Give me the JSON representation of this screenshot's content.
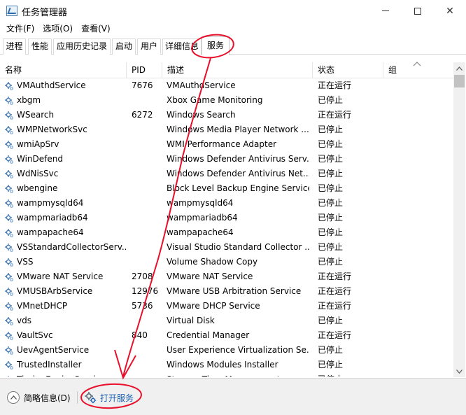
{
  "window": {
    "title": "任务管理器",
    "controls": {
      "minimize": "minimize",
      "maximize": "maximize",
      "close": "✕"
    }
  },
  "menu": {
    "items": [
      "文件(F)",
      "选项(O)",
      "查看(V)"
    ]
  },
  "tabs": [
    {
      "label": "进程"
    },
    {
      "label": "性能"
    },
    {
      "label": "应用历史记录"
    },
    {
      "label": "启动"
    },
    {
      "label": "用户"
    },
    {
      "label": "详细信息"
    },
    {
      "label": "服务",
      "active": true
    }
  ],
  "table": {
    "columns": {
      "name": "名称",
      "pid": "PID",
      "desc": "描述",
      "status": "状态",
      "group": "组"
    },
    "rows": [
      {
        "name": "VMAuthdService",
        "pid": "7676",
        "desc": "VMAuthdService",
        "status": "正在运行"
      },
      {
        "name": "xbgm",
        "pid": "",
        "desc": "Xbox Game Monitoring",
        "status": "已停止"
      },
      {
        "name": "WSearch",
        "pid": "6272",
        "desc": "Windows Search",
        "status": "正在运行"
      },
      {
        "name": "WMPNetworkSvc",
        "pid": "",
        "desc": "Windows Media Player Network ...",
        "status": "已停止"
      },
      {
        "name": "wmiApSrv",
        "pid": "",
        "desc": "WMI Performance Adapter",
        "status": "已停止"
      },
      {
        "name": "WinDefend",
        "pid": "",
        "desc": "Windows Defender Antivirus Serv...",
        "status": "已停止"
      },
      {
        "name": "WdNisSvc",
        "pid": "",
        "desc": "Windows Defender Antivirus Net...",
        "status": "已停止"
      },
      {
        "name": "wbengine",
        "pid": "",
        "desc": "Block Level Backup Engine Service",
        "status": "已停止"
      },
      {
        "name": "wampmysqld64",
        "pid": "",
        "desc": "wampmysqld64",
        "status": "已停止"
      },
      {
        "name": "wampmariadb64",
        "pid": "",
        "desc": "wampmariadb64",
        "status": "已停止"
      },
      {
        "name": "wampapache64",
        "pid": "",
        "desc": "wampapache64",
        "status": "已停止"
      },
      {
        "name": "VSStandardCollectorServ...",
        "pid": "",
        "desc": "Visual Studio Standard Collector ...",
        "status": "已停止"
      },
      {
        "name": "VSS",
        "pid": "",
        "desc": "Volume Shadow Copy",
        "status": "已停止"
      },
      {
        "name": "VMware NAT Service",
        "pid": "2708",
        "desc": "VMware NAT Service",
        "status": "正在运行"
      },
      {
        "name": "VMUSBArbService",
        "pid": "12976",
        "desc": "VMware USB Arbitration Service",
        "status": "正在运行"
      },
      {
        "name": "VMnetDHCP",
        "pid": "5736",
        "desc": "VMware DHCP Service",
        "status": "正在运行"
      },
      {
        "name": "vds",
        "pid": "",
        "desc": "Virtual Disk",
        "status": "已停止"
      },
      {
        "name": "VaultSvc",
        "pid": "840",
        "desc": "Credential Manager",
        "status": "正在运行"
      },
      {
        "name": "UevAgentService",
        "pid": "",
        "desc": "User Experience Virtualization Se...",
        "status": "已停止"
      },
      {
        "name": "TrustedInstaller",
        "pid": "",
        "desc": "Windows Modules Installer",
        "status": "已停止"
      },
      {
        "name": "TieringEngineService",
        "pid": "",
        "desc": "Storage Tiers Management",
        "status": "已停止"
      }
    ]
  },
  "footer": {
    "fewer_details": "简略信息(D)",
    "open_services": "打开服务"
  },
  "colors": {
    "link": "#1a5fb4",
    "annotation": "#e8102a",
    "service_icon": "#4a7fb8"
  }
}
